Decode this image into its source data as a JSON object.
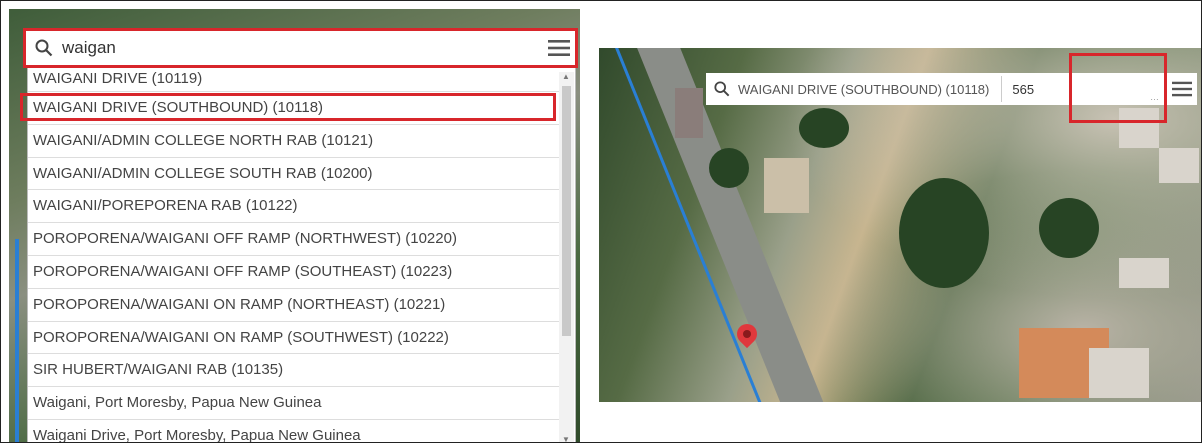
{
  "search_panel": {
    "query": "waigan",
    "results": [
      "WAIGANI DRIVE (10119)",
      "WAIGANI DRIVE (SOUTHBOUND) (10118)",
      "WAIGANI/ADMIN COLLEGE NORTH RAB (10121)",
      "WAIGANI/ADMIN COLLEGE SOUTH RAB (10200)",
      "WAIGANI/POREPORENA RAB (10122)",
      "POROPORENA/WAIGANI OFF RAMP (NORTHWEST) (10220)",
      "POROPORENA/WAIGANI OFF RAMP (SOUTHEAST) (10223)",
      "POROPORENA/WAIGANI ON RAMP (NORTHEAST) (10221)",
      "POROPORENA/WAIGANI ON RAMP (SOUTHWEST) (10222)",
      "SIR HUBERT/WAIGANI RAB (10135)",
      "Waigani, Port Moresby, Papua New Guinea",
      "Waigani Drive, Port Moresby, Papua New Guinea"
    ],
    "highlighted_result": "WAIGANI DRIVE (SOUTHBOUND) (10118)"
  },
  "map_panel": {
    "selected_location": "WAIGANI DRIVE (SOUTHBOUND) (10118)",
    "value": "565"
  },
  "icons": {
    "search": "search-icon",
    "menu": "hamburger-menu-icon",
    "pin": "map-pin-icon"
  },
  "colors": {
    "highlight": "#d8262b",
    "route": "#2a7fd4",
    "pin": "#e0383c"
  }
}
